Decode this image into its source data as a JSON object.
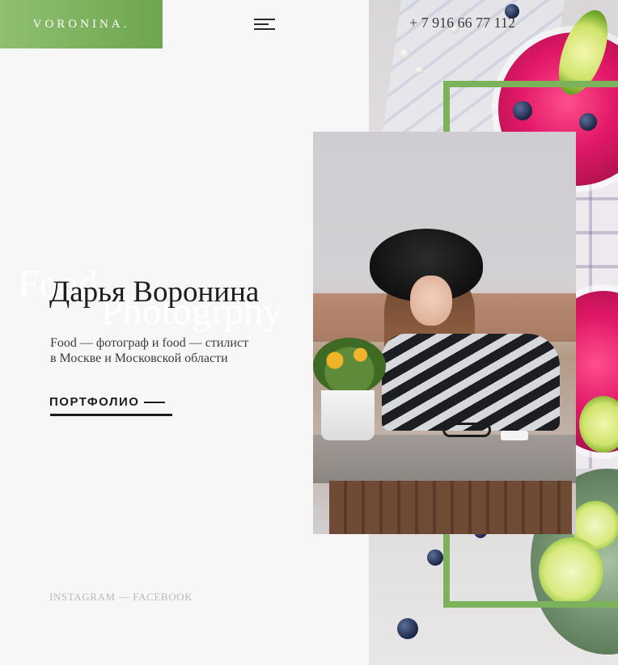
{
  "header": {
    "logo": "VORONINA.",
    "phone": "+ 7 916 66 77 112",
    "menu_icon": "hamburger-menu-icon"
  },
  "hero": {
    "watermark_line1": "Food",
    "watermark_line2": "Photogrphy",
    "name": "Дарья Воронина",
    "subtitle_line1": "Food — фотограф и food — стилист",
    "subtitle_line2": "в Москве и Московской области",
    "cta_label": "ПОРТФОЛИО"
  },
  "social": {
    "instagram": "INSTAGRAM",
    "separator": "—",
    "facebook": "FACEBOOK"
  },
  "colors": {
    "accent_green": "#7db25c",
    "background": "#f7f7f7",
    "text": "#1d1d1f"
  }
}
